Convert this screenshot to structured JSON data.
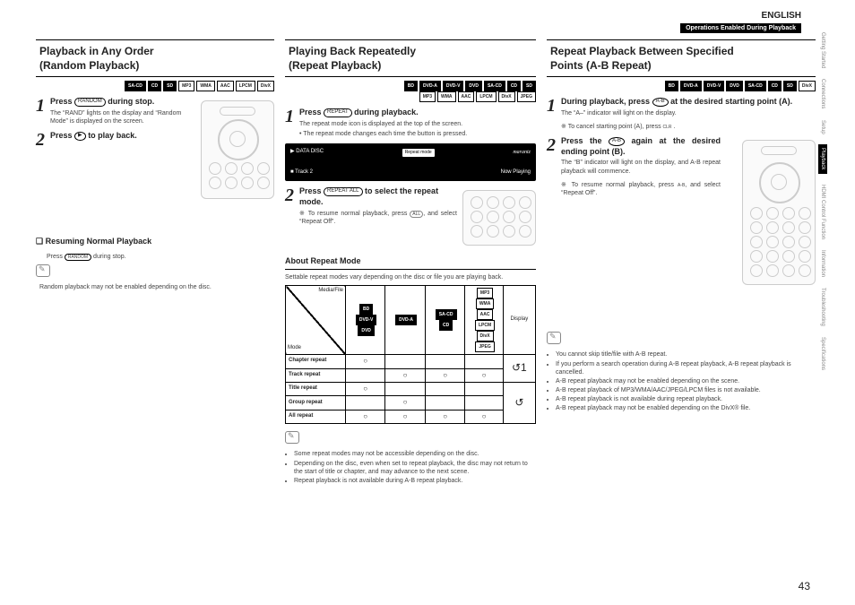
{
  "header": {
    "language": "ENGLISH",
    "section": "Operations Enabled During Playback",
    "page": "43"
  },
  "sideTabs": [
    "Getting Started",
    "Connections",
    "Setup",
    "Playback",
    "HDMI Control Function",
    "Information",
    "Troubleshooting",
    "Specifications"
  ],
  "fmt": {
    "col1": [
      "SA-CD",
      "CD",
      "SD",
      "MP3",
      "WMA",
      "AAC",
      "LPCM",
      "DivX"
    ],
    "col2a": [
      "BD",
      "DVD-A",
      "DVD-V",
      "DVD",
      "SA-CD",
      "CD",
      "SD"
    ],
    "col2b": [
      "MP3",
      "WMA",
      "AAC",
      "LPCM",
      "DivX",
      "JPEG"
    ],
    "col3a": [
      "BD",
      "DVD-A",
      "DVD-V",
      "DVD",
      "SA-CD",
      "CD",
      "SD",
      "DivX"
    ]
  },
  "col1": {
    "titleA": "Playback in Any Order",
    "titleB": "(Random Playback)",
    "s1": {
      "text": "Press",
      "btn": "RANDOM",
      "cont": "during stop.",
      "sub": "The “RAND” lights on the display and “Random Mode” is displayed on the screen."
    },
    "s2": {
      "text": "Press",
      "btn": "▶",
      "cont": "to play back."
    },
    "resumeH": "❏ Resuming Normal Playback",
    "resumeBody": {
      "a": "Press",
      "btn": "RANDOM",
      "b": "during stop."
    },
    "note": "Random playback may not be enabled depending on the disc."
  },
  "col2": {
    "titleA": "Playing Back Repeatedly",
    "titleB": "(Repeat Playback)",
    "s1": {
      "text": "Press",
      "btn": "REPEAT",
      "cont": "during playback.",
      "sub1": "The repeat mode icon is displayed at the top of the screen.",
      "sub2": "The repeat mode changes each time the button is pressed."
    },
    "scr": {
      "disc": "DATA DISC",
      "rm": "Repeat mode",
      "brand": "marantz",
      "track": "■ Track 2",
      "np": "Now Playing"
    },
    "s2": {
      "text": "Press",
      "btn": "REPEAT ALL",
      "cont": "to select the repeat mode.",
      "note": "To resume normal playback, press ",
      "note2": ", and select “Repeat Off”."
    },
    "aboutH": "About Repeat Mode",
    "aboutP": "Settable repeat modes vary depending on the disc or file you are playing back.",
    "table": {
      "mf1": "Media/File",
      "mf2": "Mode",
      "h1": [
        "BD",
        "DVD-V",
        "DVD"
      ],
      "h2": [
        "DVD-A"
      ],
      "h3": [
        "SA-CD",
        "CD"
      ],
      "h4": [
        "MP3",
        "WMA",
        "AAC",
        "LPCM",
        "DivX",
        "JPEG"
      ],
      "h5": "Display",
      "rows": [
        "Chapter repeat",
        "Track repeat",
        "Title repeat",
        "Group repeat",
        "All repeat"
      ]
    },
    "bullets": [
      "Some repeat modes may not be accessible depending on the disc.",
      "Depending on the disc, even when set to repeat playback, the disc may not return to the start of title or chapter, and may advance to the next scene.",
      "Repeat playback is not available during A-B repeat playback."
    ]
  },
  "col3": {
    "titleA": "Repeat Playback Between Specified",
    "titleB": "Points (A-B Repeat)",
    "s1": {
      "a": "During playback, press",
      "btn": "A-B",
      "b": "at the desired starting point (A).",
      "sub": "The “A–” indicator will light on the display.",
      "cancel": "To cancel starting point (A), press",
      "cbtn": "CLR"
    },
    "s2": {
      "a": "Press the",
      "btn": "A-B",
      "b": "again at the desired ending point (B).",
      "sub": "The “B” indicator will light on the display, and A-B repeat playback will commence.",
      "resume": "To resume normal playback, press ",
      "resume2": ", and select “Repeat Off”."
    },
    "bullets": [
      "You cannot skip title/file with A-B repeat.",
      "If you perform a search operation during A-B repeat playback, A-B repeat playback is cancelled.",
      "A-B repeat playback may not be enabled depending on the scene.",
      "A-B repeat playback of MP3/WMA/AAC/JPEG/LPCM files is not available.",
      "A-B repeat playback is not available during repeat playback.",
      "A-B repeat playback may not be enabled depending on the DivX® file."
    ]
  }
}
